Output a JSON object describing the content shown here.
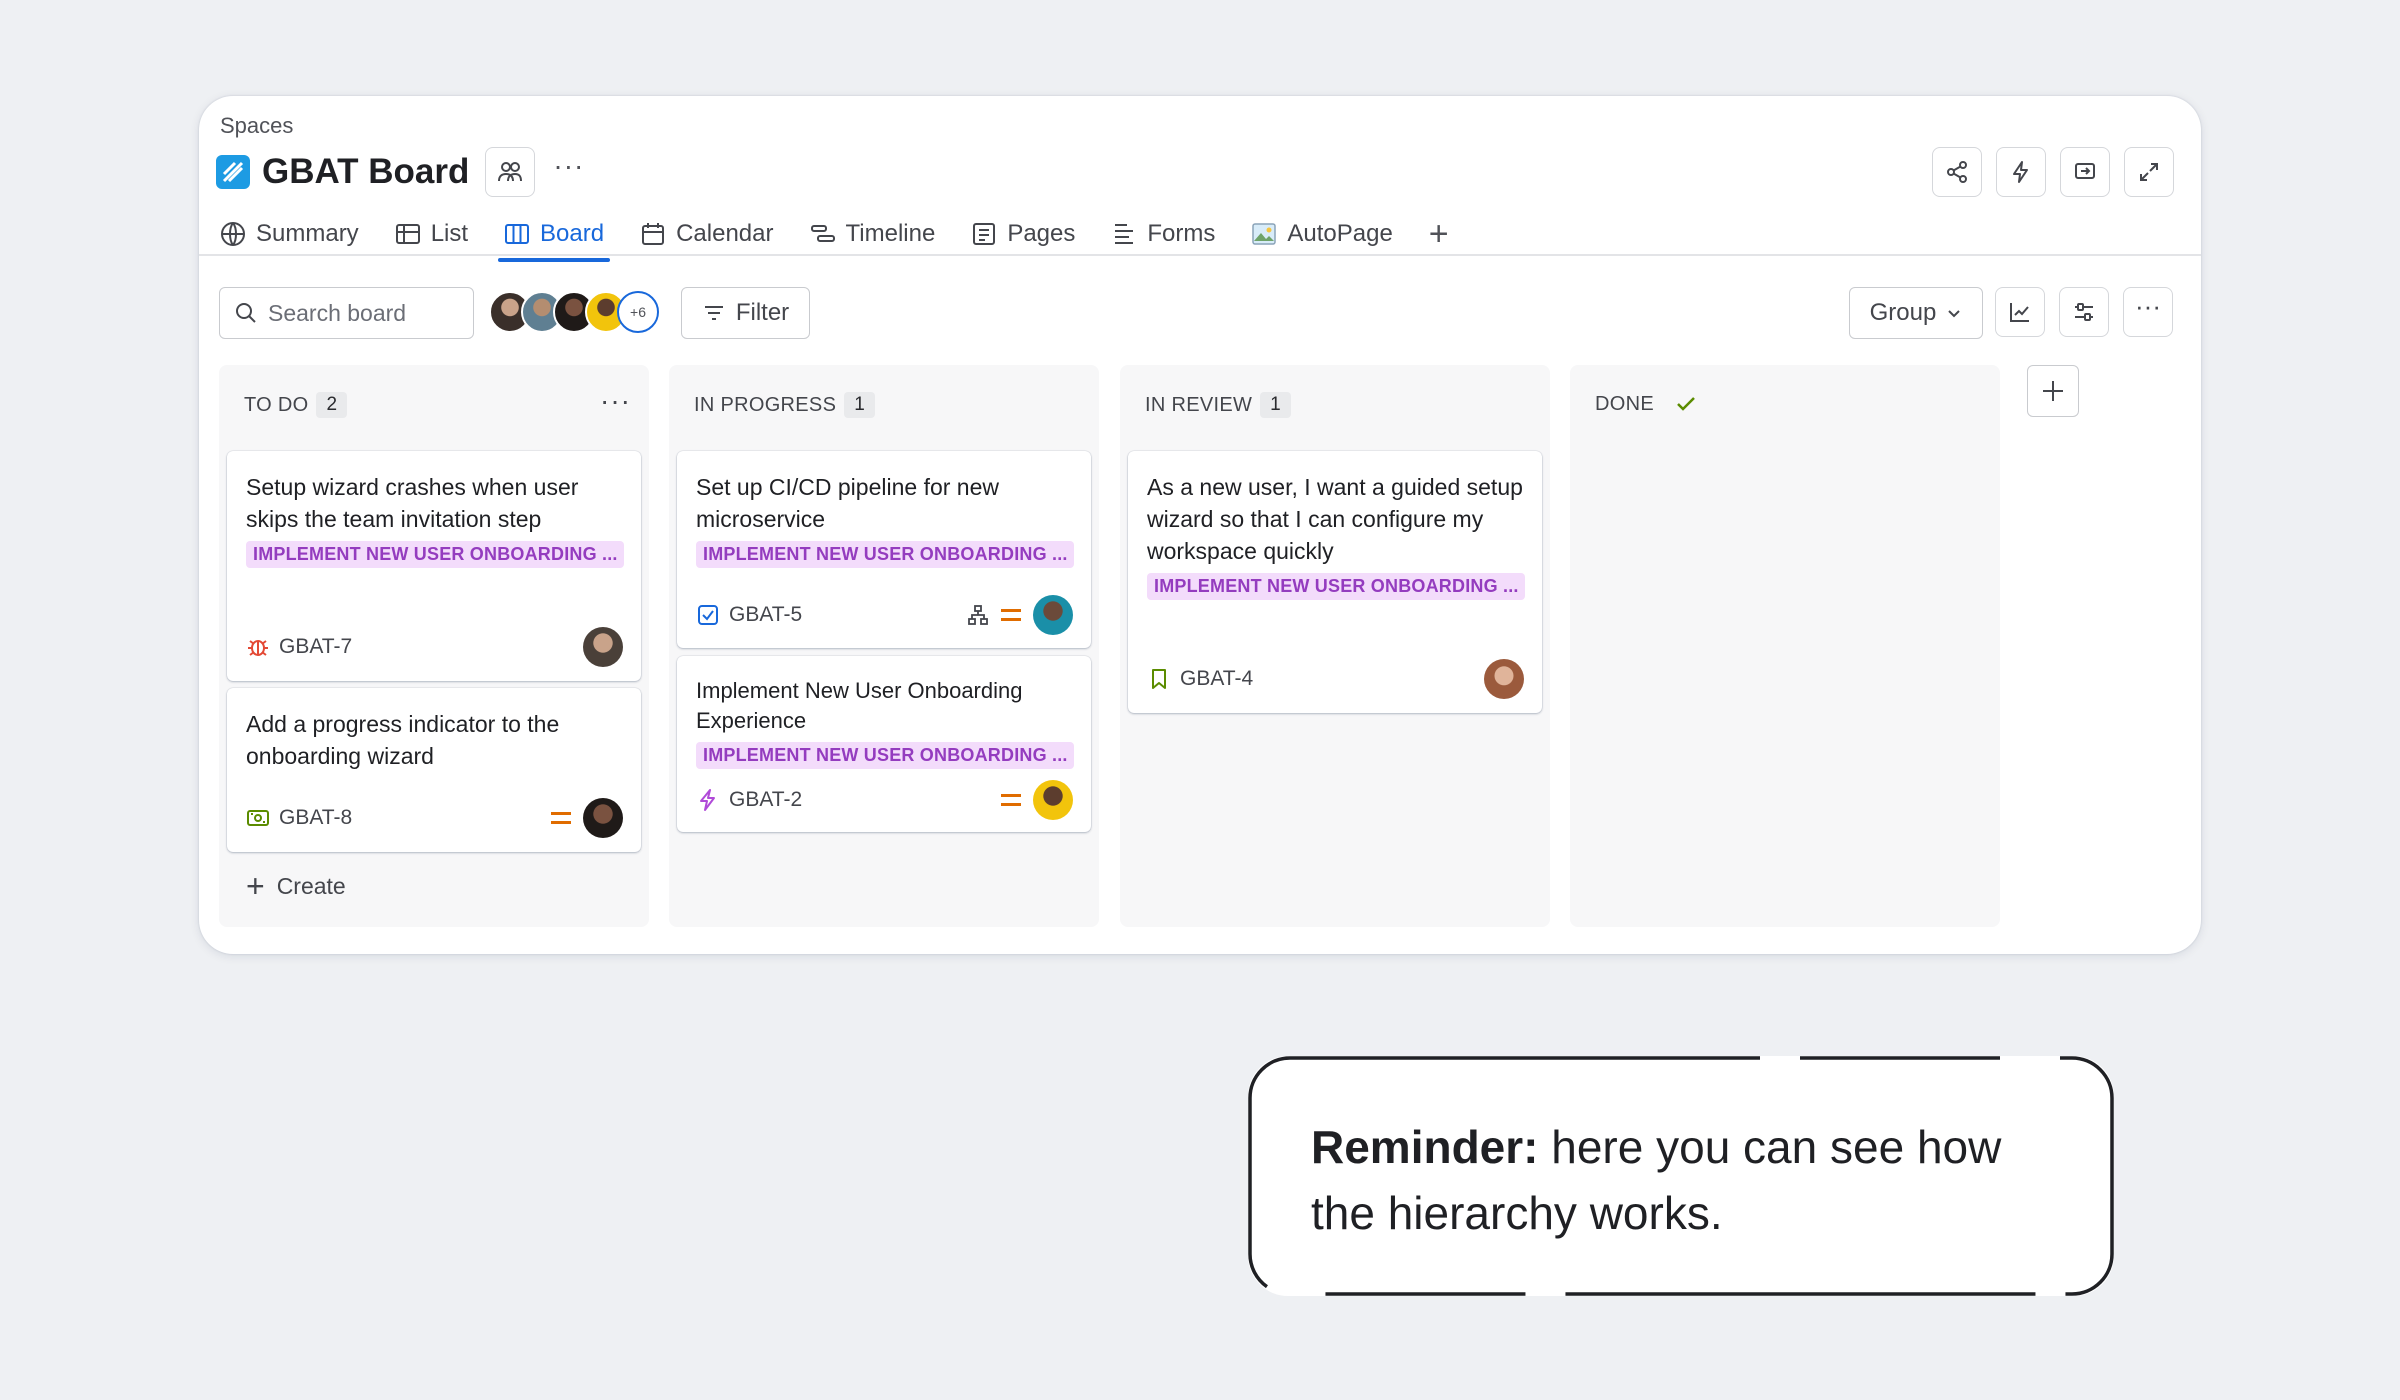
{
  "breadcrumb": "Spaces",
  "project": {
    "title": "GBAT Board"
  },
  "tabs": [
    {
      "label": "Summary",
      "icon": "globe-icon"
    },
    {
      "label": "List",
      "icon": "list-icon"
    },
    {
      "label": "Board",
      "icon": "board-icon",
      "active": true
    },
    {
      "label": "Calendar",
      "icon": "calendar-icon"
    },
    {
      "label": "Timeline",
      "icon": "timeline-icon"
    },
    {
      "label": "Pages",
      "icon": "pages-icon"
    },
    {
      "label": "Forms",
      "icon": "forms-icon"
    },
    {
      "label": "AutoPage",
      "icon": "image-icon"
    }
  ],
  "toolbar": {
    "search_placeholder": "Search board",
    "avatars_more": "+6",
    "filter_label": "Filter",
    "group_label": "Group"
  },
  "columns": [
    {
      "name": "TO DO",
      "count": "2",
      "cards": [
        {
          "title": "Setup wizard crashes when user skips the team invitation step",
          "label": "IMPLEMENT NEW USER ONBOARDING ...",
          "key": "GBAT-7",
          "type": "bug-icon"
        },
        {
          "title": "Add a progress indicator to the onboarding wizard",
          "key": "GBAT-8",
          "type": "task-icon"
        }
      ],
      "create_label": "Create"
    },
    {
      "name": "IN PROGRESS",
      "count": "1",
      "cards": [
        {
          "title": "Set up CI/CD pipeline for new microservice",
          "label": "IMPLEMENT NEW USER ONBOARDING ...",
          "key": "GBAT-5",
          "type": "checkbox-icon"
        },
        {
          "title": "Implement New User Onboarding Experience",
          "label": "IMPLEMENT NEW USER ONBOARDING ...",
          "key": "GBAT-2",
          "type": "epic-icon"
        }
      ]
    },
    {
      "name": "IN REVIEW",
      "count": "1",
      "cards": [
        {
          "title": "As a new user, I want a guided setup wizard so that I can configure my workspace quickly",
          "label": "IMPLEMENT NEW USER ONBOARDING ...",
          "key": "GBAT-4",
          "type": "story-icon"
        }
      ]
    },
    {
      "name": "DONE",
      "count": ""
    }
  ],
  "reminder": {
    "bold": "Reminder:",
    "text": " here you can see how the hierarchy works."
  },
  "colors": {
    "accent": "#1868db",
    "label_bg": "#f3dcfb",
    "label_fg": "#943cbf",
    "priority": "#e06c00",
    "done_check": "#5b8c00"
  }
}
